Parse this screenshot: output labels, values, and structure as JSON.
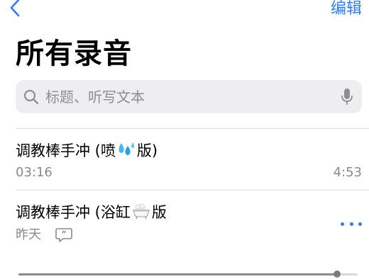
{
  "nav": {
    "back_icon": "chevron-left-icon",
    "edit_label": "编辑",
    "accent_color": "#2f7cf6"
  },
  "title": "所有录音",
  "search": {
    "placeholder": "标题、听写文本",
    "icon": "search-icon",
    "mic_icon": "microphone-icon"
  },
  "recordings": [
    {
      "title_prefix": "调教棒手冲 (喷",
      "emoji": "droplets-emoji",
      "title_suffix": "版)",
      "date": "03:16",
      "duration": "4:53"
    },
    {
      "title_prefix": "调教棒手冲 (浴缸",
      "emoji": "bathtub-emoji",
      "title_suffix": "版",
      "date": "昨天",
      "transcript_icon": "transcript-quote-icon",
      "more_icon": "more-ellipsis-icon"
    }
  ],
  "playback": {
    "progress": 0.94
  }
}
